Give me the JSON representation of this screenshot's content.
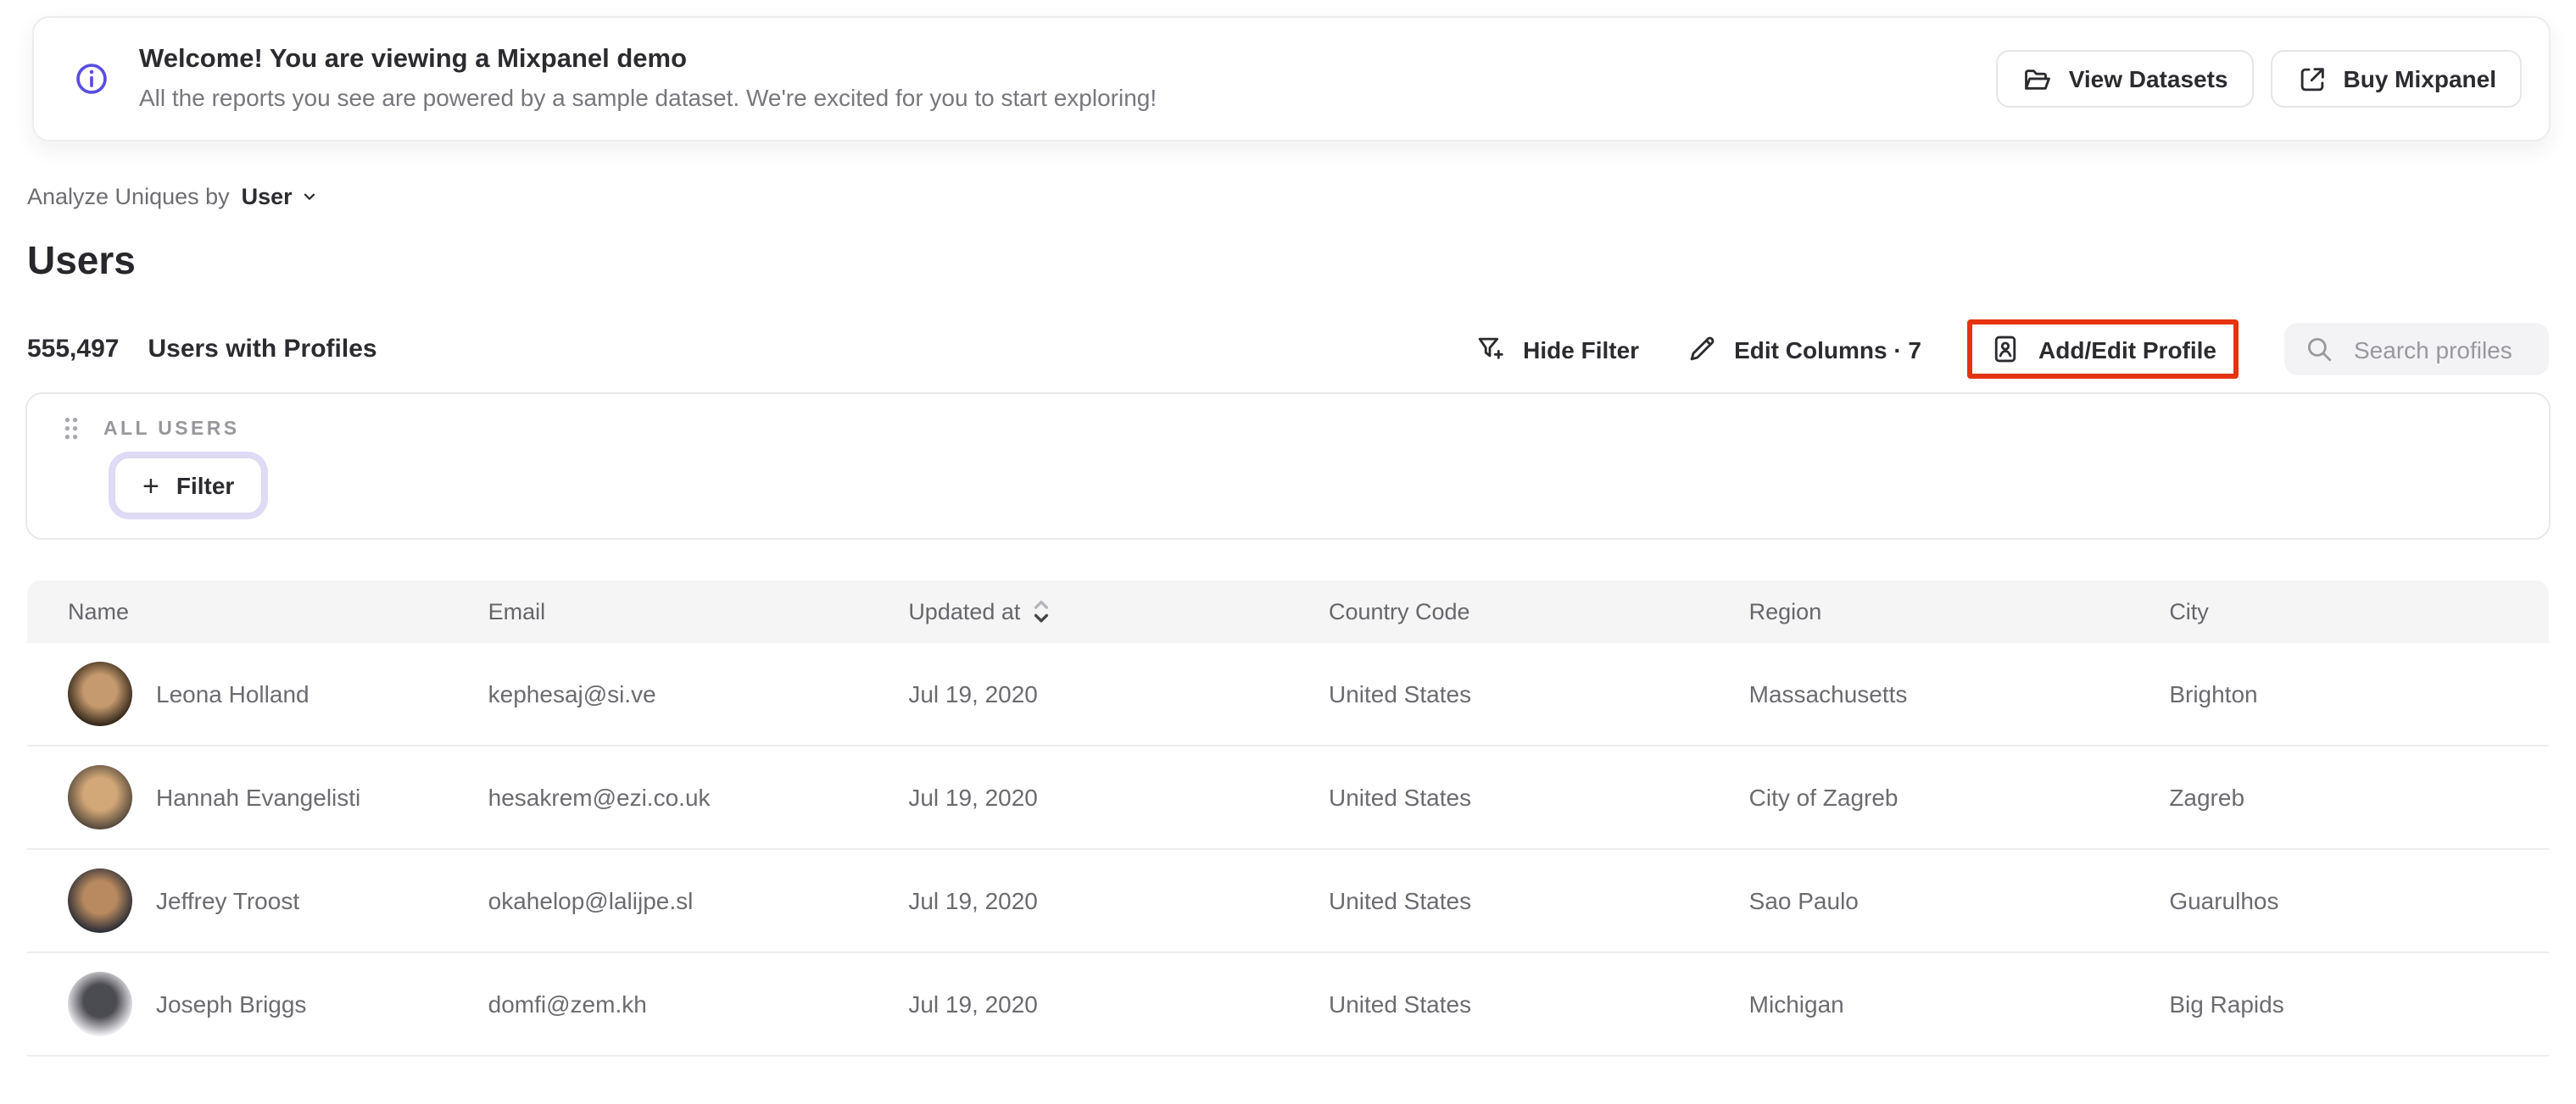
{
  "banner": {
    "title": "Welcome! You are viewing a Mixpanel demo",
    "subtitle": "All the reports you see are powered by a sample dataset. We're excited for you to start exploring!",
    "view_datasets_label": "View Datasets",
    "buy_mixpanel_label": "Buy Mixpanel"
  },
  "controls": {
    "analyze_label": "Analyze Uniques by",
    "analyze_value": "User"
  },
  "page": {
    "title": "Users"
  },
  "stats": {
    "count": "555,497",
    "label": "Users with Profiles"
  },
  "toolbar": {
    "hide_filter_label": "Hide Filter",
    "edit_columns_label": "Edit Columns · 7",
    "add_edit_profile_label": "Add/Edit Profile",
    "search_placeholder": "Search profiles"
  },
  "filter_panel": {
    "group_label": "ALL USERS",
    "filter_button_label": "Filter",
    "plus_glyph": "+"
  },
  "table": {
    "columns": [
      "Name",
      "Email",
      "Updated at",
      "Country Code",
      "Region",
      "City"
    ],
    "sorted_column": "Updated at",
    "sort_direction": "desc",
    "rows": [
      {
        "name": "Leona Holland",
        "email": "kephesaj@si.ve",
        "updated_at": "Jul 19, 2020",
        "country_code": "United States",
        "region": "Massachusetts",
        "city": "Brighton",
        "avatar": {
          "skin": "#c59a6e",
          "bg": "#35281a"
        }
      },
      {
        "name": "Hannah Evangelisti",
        "email": "hesakrem@ezi.co.uk",
        "updated_at": "Jul 19, 2020",
        "country_code": "United States",
        "region": "City of Zagreb",
        "city": "Zagreb",
        "avatar": {
          "skin": "#d3a878",
          "bg": "#574a3c"
        }
      },
      {
        "name": "Jeffrey Troost",
        "email": "okahelop@lalijpe.sl",
        "updated_at": "Jul 19, 2020",
        "country_code": "United States",
        "region": "Sao Paulo",
        "city": "Guarulhos",
        "avatar": {
          "skin": "#b98a5f",
          "bg": "#2e2f38"
        }
      },
      {
        "name": "Joseph Briggs",
        "email": "domfi@zem.kh",
        "updated_at": "Jul 19, 2020",
        "country_code": "United States",
        "region": "Michigan",
        "city": "Big Rapids",
        "avatar": {
          "skin": "#4b4b52",
          "bg": "#eeeef1"
        }
      }
    ]
  },
  "colors": {
    "accent_purple": "#5a4ee0",
    "annotation_red": "#e5330f",
    "header_bg": "#f5f5f6",
    "filter_ring": "#dfdbf6"
  }
}
